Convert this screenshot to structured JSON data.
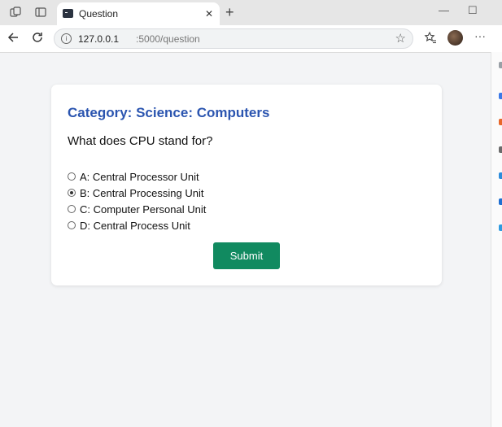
{
  "browser": {
    "tab_title": "Question",
    "address_host": "127.0.0.1",
    "address_path": ":5000/question"
  },
  "quiz": {
    "category": "Category: Science: Computers",
    "question": "What does CPU stand for?",
    "options": [
      {
        "label": "A: Central Processor Unit",
        "selected": false
      },
      {
        "label": "B: Central Processing Unit",
        "selected": true
      },
      {
        "label": "C: Computer Personal Unit",
        "selected": false
      },
      {
        "label": "D: Central Process Unit",
        "selected": false
      }
    ],
    "submit_label": "Submit"
  },
  "colors": {
    "category_text": "#2b55b0",
    "submit_button": "#118a60"
  }
}
